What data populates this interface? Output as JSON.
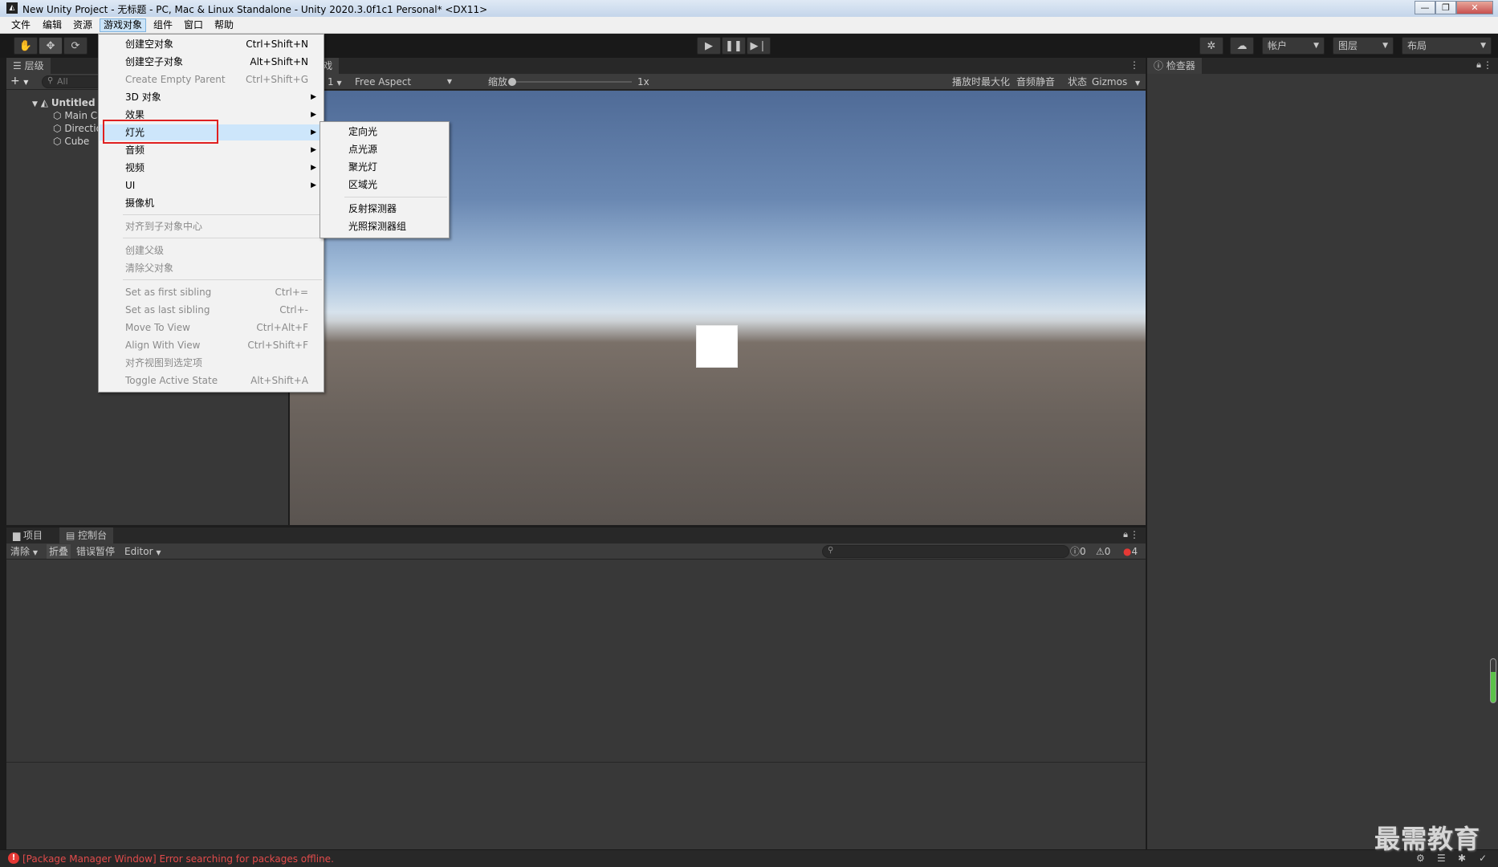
{
  "titlebar": {
    "title": "New Unity Project - 无标题 - PC, Mac & Linux Standalone - Unity 2020.3.0f1c1 Personal* <DX11>",
    "minimize": "—",
    "restore": "❐",
    "close": "✕"
  },
  "menubar": [
    "文件",
    "编辑",
    "资源",
    "游戏对象",
    "组件",
    "窗口",
    "帮助"
  ],
  "toolbar": {
    "account": "帐户",
    "layers": "图层",
    "layout": "布局"
  },
  "hierarchy": {
    "tab": "层级",
    "search_placeholder": "All",
    "add": "+",
    "scene": "Untitled",
    "items": [
      "Main Camera",
      "Directional Light",
      "Cube"
    ]
  },
  "game": {
    "scene_tab": "",
    "game_tab": "游戏",
    "display": "1",
    "aspect": "Free Aspect",
    "scale_label": "缩放",
    "scale_value": "1x",
    "maximize_on_play": "播放时最大化",
    "mute_audio": "音频静音",
    "stats": "状态",
    "gizmos": "Gizmos"
  },
  "inspector": {
    "tab": "检查器"
  },
  "console": {
    "tab_project": "项目",
    "tab_console": "控制台",
    "clear": "清除",
    "collapse": "折叠",
    "error_pause": "错误暂停",
    "editor": "Editor",
    "count_info": "0",
    "count_warn": "0",
    "count_error": "4"
  },
  "statusbar": {
    "message": "[Package Manager Window] Error searching for packages offline."
  },
  "gameobject_menu": [
    {
      "label": "创建空对象",
      "shortcut": "Ctrl+Shift+N",
      "disabled": false
    },
    {
      "label": "创建空子对象",
      "shortcut": "Alt+Shift+N",
      "disabled": false
    },
    {
      "label": "Create Empty Parent",
      "shortcut": "Ctrl+Shift+G",
      "disabled": true
    },
    {
      "label": "3D 对象",
      "submenu": true
    },
    {
      "label": "效果",
      "submenu": true
    },
    {
      "label": "灯光",
      "submenu": true,
      "highlighted": true
    },
    {
      "label": "音频",
      "submenu": true
    },
    {
      "label": "视频",
      "submenu": true
    },
    {
      "label": "UI",
      "submenu": true
    },
    {
      "label": "摄像机"
    },
    {
      "label": "对齐到子对象中心",
      "disabled": true
    },
    {
      "label": "创建父级",
      "disabled": true
    },
    {
      "label": "清除父对象",
      "disabled": true
    },
    {
      "label": "Set as first sibling",
      "shortcut": "Ctrl+=",
      "disabled": true
    },
    {
      "label": "Set as last sibling",
      "shortcut": "Ctrl+-",
      "disabled": true
    },
    {
      "label": "Move To View",
      "shortcut": "Ctrl+Alt+F",
      "disabled": true
    },
    {
      "label": "Align With View",
      "shortcut": "Ctrl+Shift+F",
      "disabled": true
    },
    {
      "label": "对齐视图到选定项",
      "disabled": true
    },
    {
      "label": "Toggle Active State",
      "shortcut": "Alt+Shift+A",
      "disabled": true
    }
  ],
  "light_submenu": [
    "定向光",
    "点光源",
    "聚光灯",
    "区域光",
    "反射探测器",
    "光照探测器组"
  ],
  "watermark": "最需教育",
  "colors": {
    "menu_highlight_box": "#e02020",
    "error_icon": "#e53935",
    "status_text": "#e24b4b"
  }
}
